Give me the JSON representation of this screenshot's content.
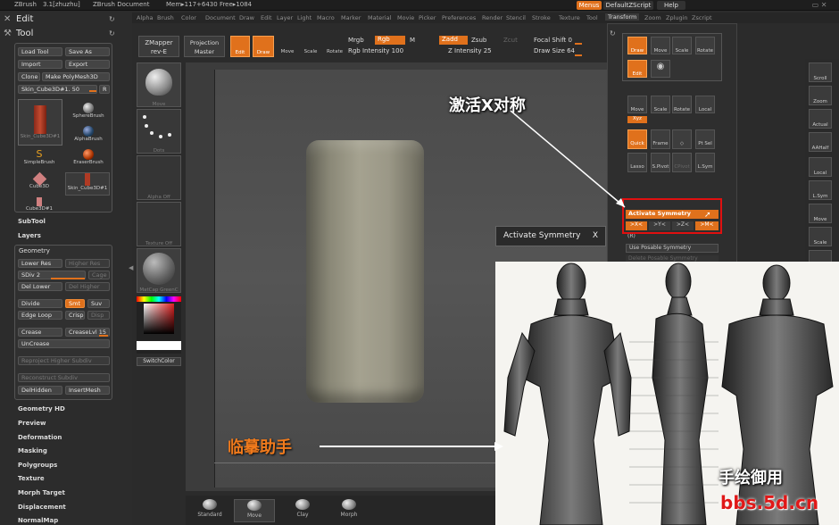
{
  "topbar": {
    "app": "ZBrush",
    "version": "3.1[zhuzhu]",
    "document": "ZBrush Document",
    "mem": "Mem▸117+6430 Free▸1084",
    "menus_btn": "Menus",
    "script": "DefaultZScript",
    "help": "Help"
  },
  "menubar": [
    "Alpha",
    "Brush",
    "Color",
    "Document",
    "Draw",
    "Edit",
    "Layer",
    "Light",
    "Macro",
    "Marker",
    "Material",
    "Movie",
    "Picker",
    "Preferences",
    "Render",
    "Stencil",
    "Stroke",
    "Texture",
    "Tool",
    "Transform",
    "Zoom",
    "Zplugin",
    "Zscript"
  ],
  "palettes": {
    "edit": "Edit",
    "tool": "Tool"
  },
  "tool_buttons": {
    "load": "Load Tool",
    "save": "Save As",
    "import": "Import",
    "export": "Export",
    "clone": "Clone",
    "make_poly": "Make PolyMesh3D",
    "current": "Skin_Cube3D#1. 50",
    "r": "R"
  },
  "tool_items": [
    "Skin_Cube3D#1",
    "SphereBrush",
    "AlphaBrush",
    "SimpleBrush",
    "EraserBrush",
    "Cube3D",
    "Skin_Cube3D#1",
    "Cube3D#1"
  ],
  "subtool": "SubTool",
  "layers": "Layers",
  "geometry": {
    "title": "Geometry",
    "lower_res": "Lower Res",
    "higher_res": "Higher Res",
    "sdiv": "SDiv 2",
    "cage": "Cage",
    "del_lower": "Del Lower",
    "del_higher": "Del Higher",
    "divide": "Divide",
    "smt": "Smt",
    "suv": "Suv",
    "edge_loop": "Edge Loop",
    "crisp": "Crisp",
    "disp": "Disp",
    "crease": "Crease",
    "crease_lvl": "CreaseLvl 15",
    "uncrease": "UnCrease",
    "reproject": "Reproject Higher Subdiv",
    "reconstruct": "Reconstruct Subdiv",
    "delhidden": "DelHidden",
    "insertmesh": "InsertMesh"
  },
  "sections": [
    "Geometry HD",
    "Preview",
    "Deformation",
    "Masking",
    "Polygroups",
    "Texture",
    "Morph Target",
    "Displacement",
    "NormalMap"
  ],
  "toolrow": {
    "zmapper": "ZMapper",
    "zmapper_rev": "rev-E",
    "projection": "Projection",
    "projection_sub": "Master",
    "edit": "Edit",
    "draw": "Draw",
    "move": "Move",
    "scale": "Scale",
    "rotate": "Rotate",
    "mrgb": "Mrgb",
    "rgb": "Rgb",
    "m": "M",
    "rgb_intensity": "Rgb Intensity 100",
    "zadd": "Zadd",
    "zsub": "Zsub",
    "zcut": "Zcut",
    "z_intensity": "Z Intensity 25",
    "focal_shift": "Focal Shift 0",
    "draw_size": "Draw Size 64"
  },
  "shelf": [
    "Move",
    "Dots",
    "Alpha Off",
    "Texture Off",
    "MatCap GreenC"
  ],
  "switchcolor": "SwitchColor",
  "bottom_brushes": [
    "Standard",
    "Move",
    "Clay",
    "Morph"
  ],
  "transform": {
    "title": "Transform",
    "draw": "Draw",
    "move": "Move",
    "scale": "Scale",
    "rotate": "Rotate",
    "edit": "Edit",
    "quick": "Quick",
    "frame": "Frame",
    "pt_sel": "Pt Sel",
    "lasso": "Lasso",
    "s_pivot": "S.Pivot",
    "c_pivot": "CPivot",
    "l_sym": "L.Sym",
    "local": "Local",
    "xyz": "Xyz",
    "activate_symmetry": "Activate Symmetry",
    "sym_x": ">X<",
    "sym_y": ">Y<",
    "sym_z": ">Z<",
    "sym_m": ">M<",
    "r": "(R)",
    "posable": "Use Posable Symmetry",
    "delete_posable": "Delete Posable Symmetry"
  },
  "right_strip": [
    "Scroll",
    "Zoom",
    "Actual",
    "AAHalf",
    "Local",
    "L.Sym",
    "Move",
    "Scale",
    "Rotate"
  ],
  "tooltip": {
    "text": "Activate Symmetry",
    "close": "X"
  },
  "annotations": {
    "symmetry_cn": "激活X对称",
    "helper_cn": "临摹助手",
    "watermark_cn": "手绘御用",
    "watermark_url": "bbs.5d.cn"
  }
}
